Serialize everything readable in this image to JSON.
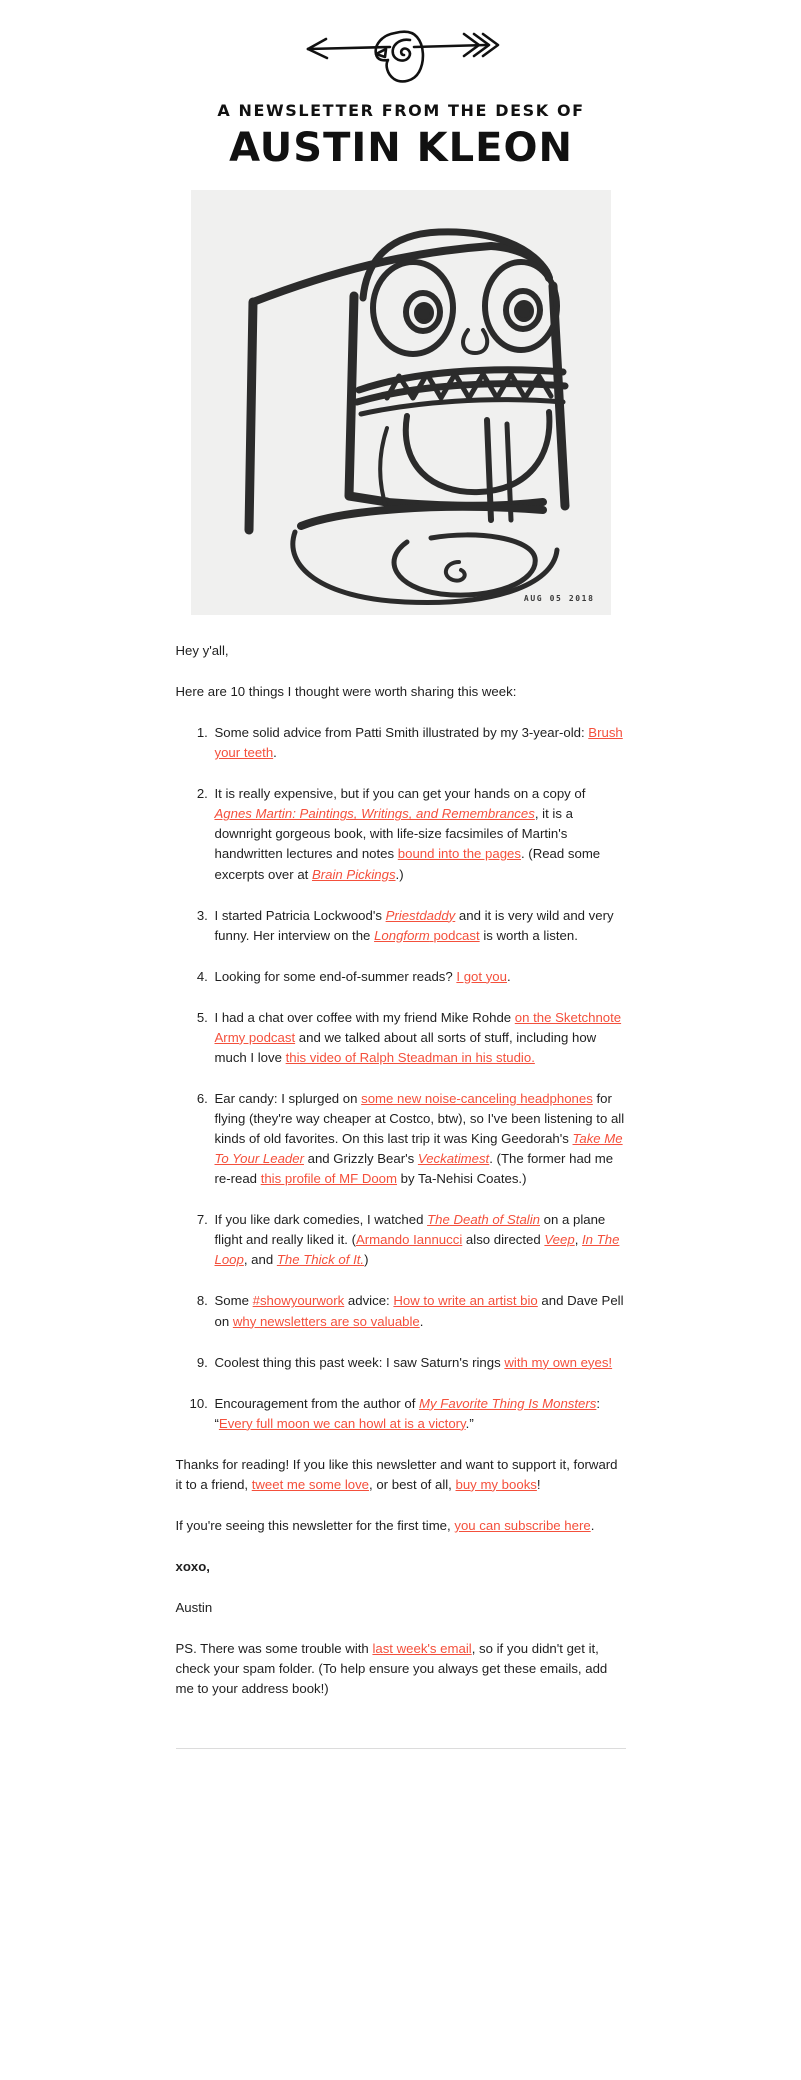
{
  "masthead": {
    "kicker": "A NEWSLETTER FROM THE DESK OF",
    "wordmark": "AUSTIN KLEON",
    "logo_icon": "arrow-through-head-icon"
  },
  "hero": {
    "alt": "child's marker drawing of a face with glasses and big teeth",
    "date_stamp": "AUG 05 2018"
  },
  "body": {
    "greeting": "Hey y'all,",
    "intro": "Here are 10 things I thought were worth sharing this week:",
    "items": [
      {
        "n": 1,
        "parts": [
          {
            "t": "Some solid advice from Patti Smith illustrated by my 3-year-old: ",
            "k": "text"
          },
          {
            "t": "Brush your teeth",
            "k": "link"
          },
          {
            "t": ".",
            "k": "text"
          }
        ]
      },
      {
        "n": 2,
        "parts": [
          {
            "t": "It is really expensive, but if you can get your hands on a copy of ",
            "k": "text"
          },
          {
            "t": "Agnes Martin: Paintings, Writings, and Remembrances",
            "k": "link-italic"
          },
          {
            "t": ", it is a downright gorgeous book, with life-size facsimiles of Martin's handwritten lectures and notes ",
            "k": "text"
          },
          {
            "t": "bound into the pages",
            "k": "link"
          },
          {
            "t": ". (Read some excerpts over at ",
            "k": "text"
          },
          {
            "t": "Brain Pickings",
            "k": "link-italic"
          },
          {
            "t": ".)",
            "k": "text"
          }
        ]
      },
      {
        "n": 3,
        "parts": [
          {
            "t": "I started Patricia Lockwood's ",
            "k": "text"
          },
          {
            "t": "Priestdaddy",
            "k": "link-italic"
          },
          {
            "t": " and it is very wild and very funny. Her interview on the ",
            "k": "text"
          },
          {
            "t": "Longform",
            "k": "link-italic"
          },
          {
            "t": " ",
            "k": "link"
          },
          {
            "t": "podcast",
            "k": "link"
          },
          {
            "t": " is worth a listen.",
            "k": "text"
          }
        ]
      },
      {
        "n": 4,
        "parts": [
          {
            "t": "Looking for some end-of-summer reads? ",
            "k": "text"
          },
          {
            "t": "I got you",
            "k": "link"
          },
          {
            "t": ".",
            "k": "text"
          }
        ]
      },
      {
        "n": 5,
        "parts": [
          {
            "t": "I had a chat over coffee with my friend Mike Rohde ",
            "k": "text"
          },
          {
            "t": "on the Sketchnote Army podcast",
            "k": "link"
          },
          {
            "t": " and we talked about all sorts of stuff, including how much I love ",
            "k": "text"
          },
          {
            "t": "this video of Ralph Steadman in his studio.",
            "k": "link"
          }
        ]
      },
      {
        "n": 6,
        "parts": [
          {
            "t": "Ear candy: I splurged on ",
            "k": "text"
          },
          {
            "t": "some new noise-canceling headphones",
            "k": "link"
          },
          {
            "t": " for flying (they're way cheaper at Costco, btw), so I've been listening to all kinds of old favorites. On this last trip it was King Geedorah's ",
            "k": "text"
          },
          {
            "t": "Take Me To Your Leader",
            "k": "link-italic"
          },
          {
            "t": " and Grizzly Bear's ",
            "k": "text"
          },
          {
            "t": "Veckatimest",
            "k": "link-italic"
          },
          {
            "t": ". (The former had me re-read ",
            "k": "text"
          },
          {
            "t": "this profile of MF Doom",
            "k": "link"
          },
          {
            "t": " by Ta-Nehisi Coates.)",
            "k": "text"
          }
        ]
      },
      {
        "n": 7,
        "parts": [
          {
            "t": "If you like dark comedies, I watched ",
            "k": "text"
          },
          {
            "t": "The Death of Stalin",
            "k": "link-italic"
          },
          {
            "t": " on a plane flight and really liked it. (",
            "k": "text"
          },
          {
            "t": "Armando Iannucci",
            "k": "link"
          },
          {
            "t": " also directed ",
            "k": "text"
          },
          {
            "t": "Veep",
            "k": "link-italic"
          },
          {
            "t": ", ",
            "k": "text"
          },
          {
            "t": "In The Loop",
            "k": "link-italic"
          },
          {
            "t": ", and ",
            "k": "text"
          },
          {
            "t": "The Thick of It.",
            "k": "link-italic"
          },
          {
            "t": ")",
            "k": "text"
          }
        ]
      },
      {
        "n": 8,
        "parts": [
          {
            "t": "Some ",
            "k": "text"
          },
          {
            "t": "#showyourwork",
            "k": "link"
          },
          {
            "t": " advice: ",
            "k": "text"
          },
          {
            "t": "How to write an artist bio",
            "k": "link"
          },
          {
            "t": " and Dave Pell on ",
            "k": "text"
          },
          {
            "t": "why newsletters are so valuable",
            "k": "link"
          },
          {
            "t": ".",
            "k": "text"
          }
        ]
      },
      {
        "n": 9,
        "parts": [
          {
            "t": "Coolest thing this past week: I saw Saturn's rings ",
            "k": "text"
          },
          {
            "t": "with my own eyes!",
            "k": "link"
          }
        ]
      },
      {
        "n": 10,
        "parts": [
          {
            "t": "Encouragement from the author of ",
            "k": "text"
          },
          {
            "t": "My Favorite Thing Is Monsters",
            "k": "link-italic"
          },
          {
            "t": ": “",
            "k": "text"
          },
          {
            "t": "Every full moon we can howl at is a victory",
            "k": "link"
          },
          {
            "t": ".”",
            "k": "text"
          }
        ]
      }
    ],
    "closing": [
      {
        "parts": [
          {
            "t": "Thanks for reading! If you like this newsletter and want to support it, forward it to a friend, ",
            "k": "text"
          },
          {
            "t": "tweet me some love",
            "k": "link"
          },
          {
            "t": ", or best of all, ",
            "k": "text"
          },
          {
            "t": "buy my books",
            "k": "link"
          },
          {
            "t": "!",
            "k": "text"
          }
        ]
      },
      {
        "parts": [
          {
            "t": "If you're seeing this newsletter for the first time, ",
            "k": "text"
          },
          {
            "t": "you can subscribe here",
            "k": "link"
          },
          {
            "t": ".",
            "k": "text"
          }
        ]
      },
      {
        "bold": true,
        "parts": [
          {
            "t": "xoxo,",
            "k": "text"
          }
        ]
      },
      {
        "parts": [
          {
            "t": "Austin",
            "k": "text"
          }
        ]
      },
      {
        "parts": [
          {
            "t": "PS. There was some trouble with ",
            "k": "text"
          },
          {
            "t": "last week's email",
            "k": "link"
          },
          {
            "t": ", so if you didn't get it, check your spam folder. (To help ensure you always get these emails, add me to your address book!)",
            "k": "text"
          }
        ]
      }
    ]
  },
  "colors": {
    "link": "#f4503c",
    "text": "#1f1f1f",
    "hero_bg": "#f0f0ef",
    "page_bg": "#ffffff"
  }
}
